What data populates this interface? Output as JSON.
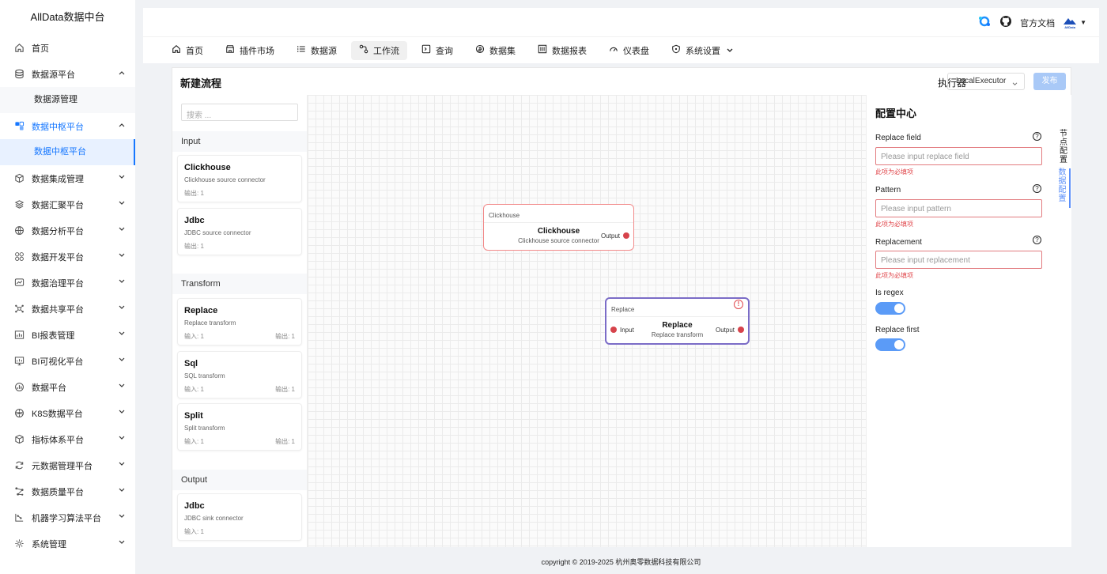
{
  "sidebar": {
    "brand": "AllData数据中台",
    "items": [
      {
        "label": "首页",
        "icon": "home-icon"
      },
      {
        "label": "数据源平台",
        "icon": "database-icon",
        "expanded": true
      },
      {
        "label": "数据中枢平台",
        "icon": "hub-icon",
        "expanded": true
      },
      {
        "label": "数据集成管理",
        "icon": "cube-icon"
      },
      {
        "label": "数据汇聚平台",
        "icon": "layers-icon"
      },
      {
        "label": "数据分析平台",
        "icon": "globe-icon"
      },
      {
        "label": "数据开发平台",
        "icon": "grid-icon"
      },
      {
        "label": "数据治理平台",
        "icon": "monitor-chart-icon"
      },
      {
        "label": "数据共享平台",
        "icon": "share-icon"
      },
      {
        "label": "BI报表管理",
        "icon": "report-icon"
      },
      {
        "label": "BI可视化平台",
        "icon": "screen-icon"
      },
      {
        "label": "数据平台",
        "icon": "bar-chart-icon"
      },
      {
        "label": "K8S数据平台",
        "icon": "k8s-icon"
      },
      {
        "label": "指标体系平台",
        "icon": "box-icon"
      },
      {
        "label": "元数据管理平台",
        "icon": "sync-icon"
      },
      {
        "label": "数据质量平台",
        "icon": "network-icon"
      },
      {
        "label": "机器学习算法平台",
        "icon": "ml-icon"
      },
      {
        "label": "系统管理",
        "icon": "settings-icon"
      }
    ],
    "sub": {
      "datasource": "数据源管理",
      "hub": "数据中枢平台"
    }
  },
  "header": {
    "docs": "官方文档",
    "logo_text": "AllData"
  },
  "topnav": [
    {
      "label": "首页",
      "icon": "home-icon"
    },
    {
      "label": "插件市场",
      "icon": "store-icon"
    },
    {
      "label": "数据源",
      "icon": "list-icon"
    },
    {
      "label": "工作流",
      "icon": "workflow-icon",
      "active": true
    },
    {
      "label": "查询",
      "icon": "terminal-icon"
    },
    {
      "label": "数据集",
      "icon": "dataset-icon"
    },
    {
      "label": "数据报表",
      "icon": "report-icon"
    },
    {
      "label": "仪表盘",
      "icon": "dashboard-icon"
    },
    {
      "label": "系统设置",
      "icon": "shield-icon"
    }
  ],
  "panel": {
    "title": "新建流程",
    "executor_label": "执行器",
    "executor_value": "LocalExecutor",
    "publish": "发布"
  },
  "palette": {
    "search_placeholder": "搜索 ...",
    "sections": {
      "input": "Input",
      "transform": "Transform",
      "output": "Output"
    },
    "cards": [
      {
        "title": "Clickhouse",
        "desc": "Clickhouse source connector",
        "io_left": "输出: 1",
        "io_right": ""
      },
      {
        "title": "Jdbc",
        "desc": "JDBC source connector",
        "io_left": "输出: 1",
        "io_right": ""
      },
      {
        "title": "Replace",
        "desc": "Replace transform",
        "io_left": "输入: 1",
        "io_right": "输出: 1"
      },
      {
        "title": "Sql",
        "desc": "SQL transform",
        "io_left": "输入: 1",
        "io_right": "输出: 1"
      },
      {
        "title": "Split",
        "desc": "Split transform",
        "io_left": "输入: 1",
        "io_right": "输出: 1"
      },
      {
        "title": "Jdbc",
        "desc": "JDBC sink connector",
        "io_left": "输入: 1",
        "io_right": ""
      }
    ]
  },
  "canvas": {
    "nodes": [
      {
        "kind": "Clickhouse",
        "title": "Clickhouse",
        "desc": "Clickhouse source connector",
        "output": "Output",
        "border": "#f28b8b"
      },
      {
        "kind": "Replace",
        "title": "Replace",
        "desc": "Replace transform",
        "input": "Input",
        "output": "Output",
        "border": "#7b6cc7"
      }
    ]
  },
  "config": {
    "title": "配置中心",
    "fields": [
      {
        "label": "Replace field",
        "placeholder": "Please input replace field",
        "error": "此项为必填项"
      },
      {
        "label": "Pattern",
        "placeholder": "Please input pattern",
        "error": "此项为必填项"
      },
      {
        "label": "Replacement",
        "placeholder": "Please input replacement",
        "error": "此项为必填项"
      }
    ],
    "toggles": [
      {
        "label": "Is regex",
        "on": true
      },
      {
        "label": "Replace first",
        "on": true
      }
    ],
    "tabs": [
      "节点配置",
      "数据配置"
    ]
  },
  "footer": "copyright © 2019-2025 杭州奥零数据科技有限公司",
  "colors": {
    "accent": "#1677ff",
    "error": "#e0464b",
    "port": "#d6434b",
    "toggle": "#5b9bf7"
  }
}
